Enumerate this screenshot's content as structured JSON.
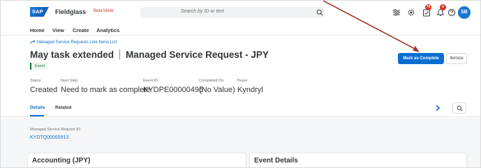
{
  "shell": {
    "logo_text": "SAP",
    "app_name": "Fieldglass",
    "beta_label": "Beta Mode",
    "search_placeholder": "Search by ID or text",
    "notifications_count": "70",
    "alerts_count": "0",
    "avatar_initials": "SB"
  },
  "nav": {
    "items": [
      "Home",
      "View",
      "Create",
      "Analytics"
    ]
  },
  "header": {
    "breadcrumb": "Managed Service Requests Line Items List",
    "title_main": "May task extended",
    "title_sub": "Managed Service Request - JPY",
    "status_chip": "Event",
    "primary_action": "Mark as Complete",
    "secondary_action": "Itemize",
    "attributes": [
      {
        "label": "Status",
        "value": "Created"
      },
      {
        "label": "Next Step",
        "value": "Need to mark as complete"
      },
      {
        "label": "Event ID",
        "value": "KYDPE00000495"
      },
      {
        "label": "Completed On",
        "value": "(No Value)"
      },
      {
        "label": "Buyer",
        "value": "Kyndryl"
      }
    ]
  },
  "tabs": {
    "items": [
      "Details",
      "Related"
    ],
    "active": "Details"
  },
  "content": {
    "request_id_label": "Managed Service Request ID",
    "request_id_value": "KYDTQ00000913",
    "sections": [
      "Accounting (JPY)",
      "Event Details"
    ]
  },
  "colors": {
    "brand_blue": "#0a6ed1",
    "alert_red": "#d0342c",
    "annotation_arrow": "#a23a2a",
    "event_green": "#107e3e"
  },
  "icons": {
    "search": "search-icon",
    "settings_lines": "settings-icon",
    "gear": "gear-icon",
    "tasks": "tasks-icon",
    "bell": "bell-icon",
    "help": "help-icon",
    "back_link": "back-arrow-icon",
    "chevron_right": "chevron-right-icon"
  }
}
